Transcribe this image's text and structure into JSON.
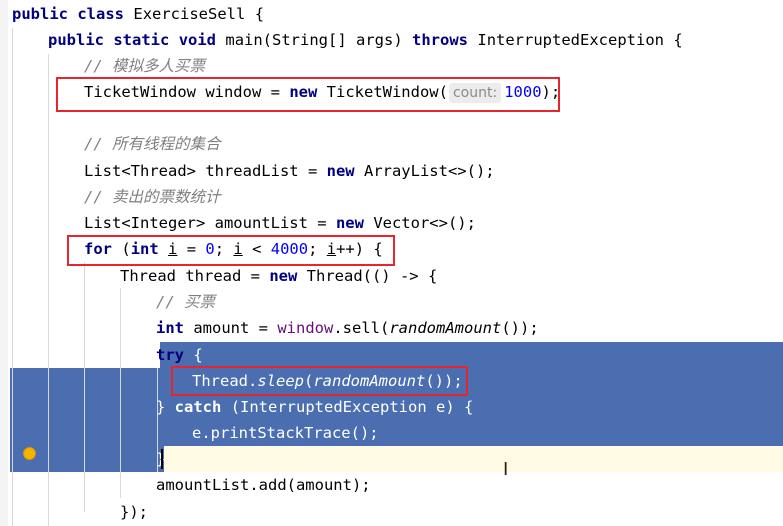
{
  "code": {
    "line1": {
      "kw1": "public",
      "kw2": "class",
      "name": "ExerciseSell",
      "brace": "{"
    },
    "line2": {
      "kw1": "public",
      "kw2": "static",
      "kw3": "void",
      "rest1": "main(String[] args)",
      "kw4": "throws",
      "rest2": "InterruptedException {"
    },
    "line3": {
      "comment": "// 模拟多人买票"
    },
    "line4": {
      "p1": "TicketWindow window = ",
      "kw": "new",
      "p2": "TicketWindow(",
      "hint": "count:",
      "num": "1000",
      "p3": ");"
    },
    "line6": {
      "comment": "// 所有线程的集合"
    },
    "line7": {
      "p1": "List<Thread> threadList = ",
      "kw": "new",
      "p2": "ArrayList<>();"
    },
    "line8": {
      "comment": "// 卖出的票数统计"
    },
    "line9": {
      "p1": "List<Integer> amountList = ",
      "kw": "new",
      "p2": "Vector<>();"
    },
    "line10": {
      "kw1": "for",
      "p1": "(",
      "kw2": "int",
      "v1": "i",
      "p2": " = ",
      "n1": "0",
      "p3": "; ",
      "v2": "i",
      "p4": " < ",
      "n2": "4000",
      "p5": "; ",
      "v3": "i",
      "p6": "++) {"
    },
    "line11": {
      "p1": "Thread thread = ",
      "kw": "new",
      "p2": "Thread(() -> {"
    },
    "line12": {
      "comment": "// 买票"
    },
    "line13": {
      "kw": "int",
      "p1": "amount = ",
      "field": "window",
      "p2": ".sell(",
      "it": "randomAmount",
      "p3": "());"
    },
    "line14": {
      "kw": "try",
      "p1": "{"
    },
    "line15": {
      "p1": "Thread.",
      "it1": "sleep",
      "p2": "(",
      "it2": "randomAmount",
      "p3": "());"
    },
    "line16": {
      "p1": "} ",
      "kw": "catch",
      "p2": "(InterruptedException e) {"
    },
    "line17": {
      "p1": "e.printStackTrace();"
    },
    "line18": {
      "p1": "}"
    },
    "line19": {
      "p1": "amountList.add(amount);"
    },
    "line20": {
      "p1": "});"
    }
  },
  "colors": {
    "keyword": "#000080",
    "comment": "#808080",
    "number": "#0000ff",
    "field": "#660e7a",
    "selection": "#4a6eb0",
    "highlight_box": "#e8242d",
    "breakpoint": "#f4b400",
    "caret_line": "#fffae3"
  },
  "icons": [
    "breakpoint-icon",
    "text-cursor-icon"
  ]
}
